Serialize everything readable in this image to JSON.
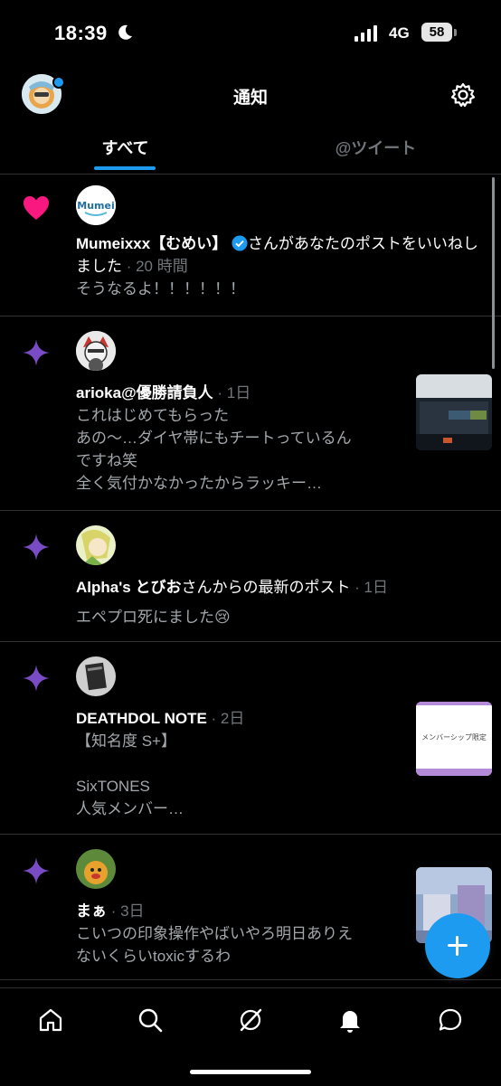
{
  "status": {
    "time": "18:39",
    "network": "4G",
    "battery": "58"
  },
  "header": {
    "title": "通知"
  },
  "tabs": [
    {
      "label": "すべて"
    },
    {
      "label": "@ツイート"
    }
  ],
  "notifications": [
    {
      "type": "like",
      "name": "Mumeixxx【むめい】",
      "after_name": "さんがあなたのポストをいいねしました",
      "time": " · 20 時間",
      "text": "そうなるよ！！！！！！"
    },
    {
      "type": "star",
      "name": "arioka@優勝請負人",
      "time": " · 1日",
      "lines": [
        "これはじめてもらった",
        "あの〜…ダイヤ帯にもチートっているん",
        "ですね笑",
        "全く気付かなかったからラッキー…"
      ]
    },
    {
      "type": "star",
      "name": "Alpha's とびお",
      "after_name": "さんからの最新のポスト",
      "time": " · 1日",
      "text": "エペプロ死にました😢"
    },
    {
      "type": "star",
      "name": "DEATHDOL NOTE",
      "time": " · 2日",
      "lines": [
        "【知名度 S+】",
        "",
        "SixTONES",
        "人気メンバー…"
      ],
      "thumb_text": "メンバーシップ限定"
    },
    {
      "type": "star",
      "name": "まぁ",
      "time": " · 3日",
      "lines": [
        "こいつの印象操作やばいやろ明日ありえ",
        "ないくらいtoxicするわ"
      ]
    }
  ],
  "avatar_labels": {
    "mumei": "Mumei"
  },
  "icons": {
    "like": "heart-icon",
    "star": "sparkle-icon",
    "settings": "gear-icon",
    "nav": [
      "home-icon",
      "search-icon",
      "grok-icon",
      "bell-icon",
      "message-icon"
    ],
    "compose": "plus-icon"
  },
  "colors": {
    "accent": "#1d9bf0",
    "like": "#f91880",
    "sparkle": "#794bc4",
    "background": "#000000"
  }
}
